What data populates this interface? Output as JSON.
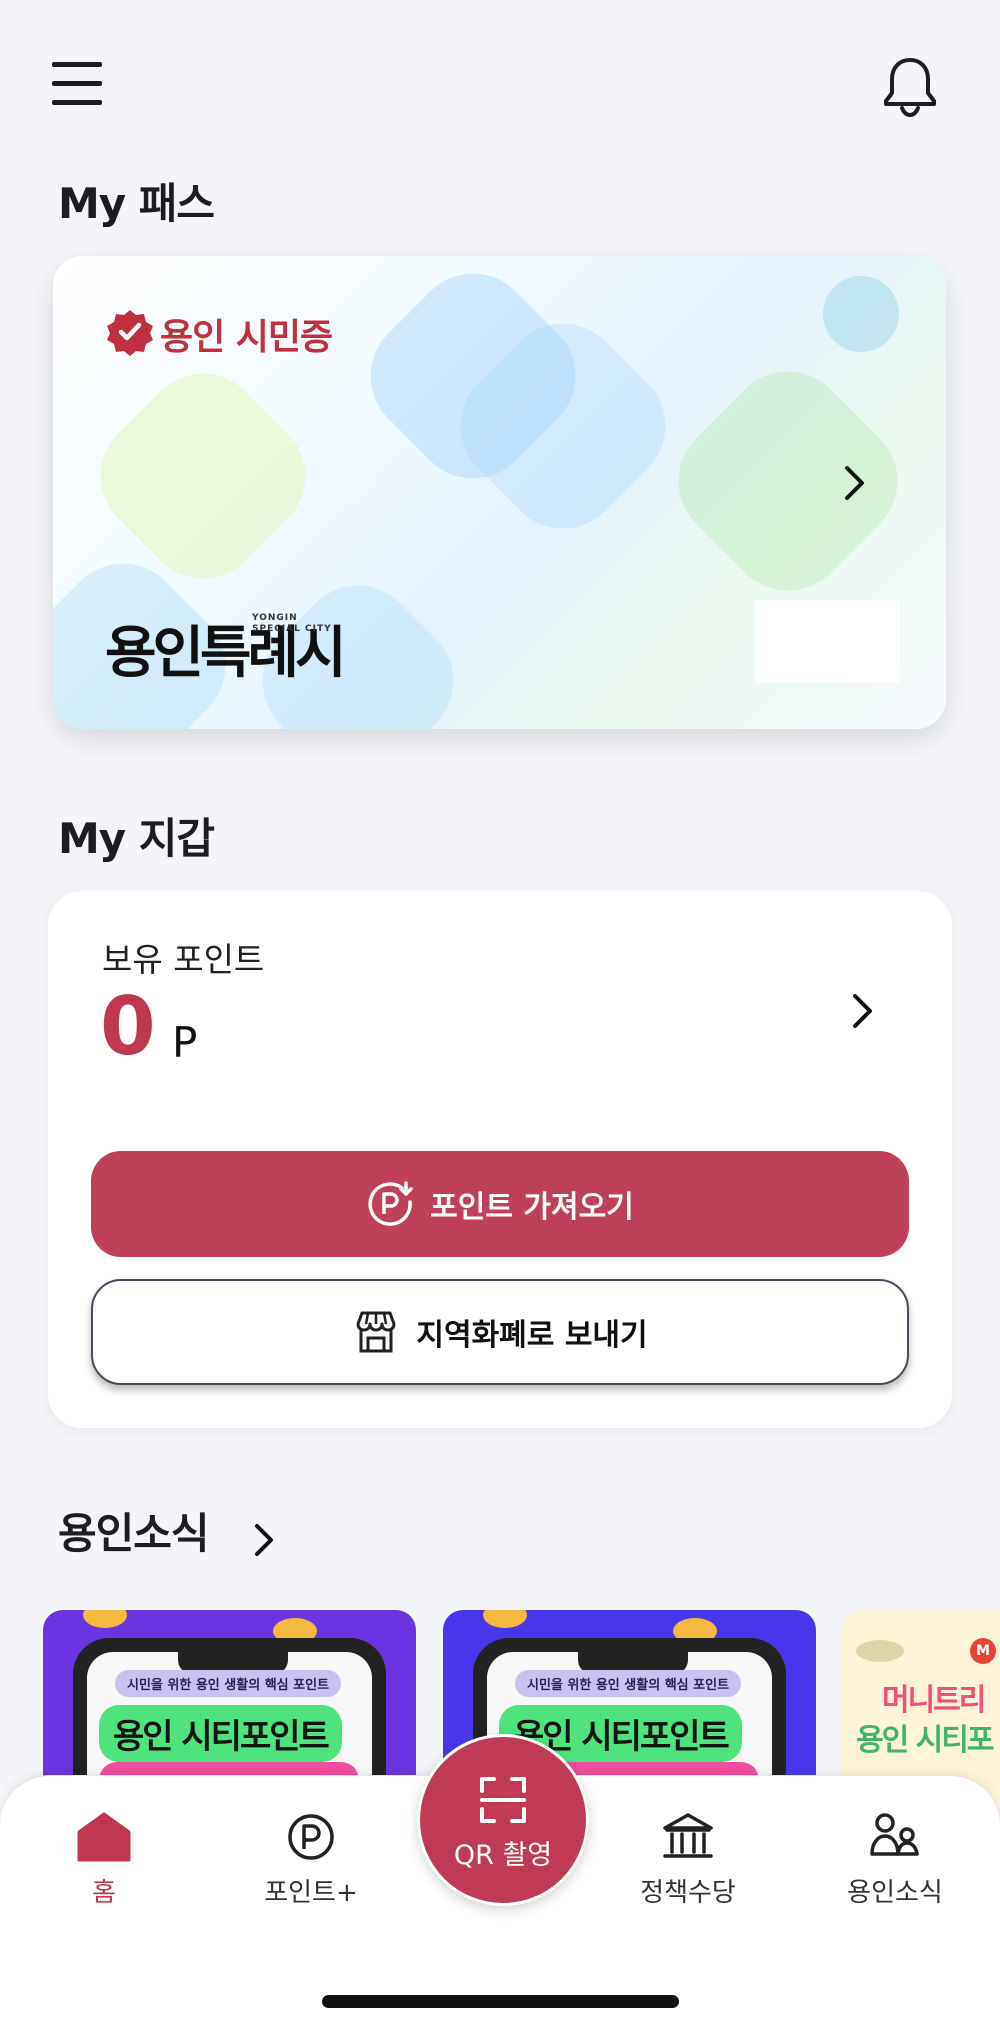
{
  "header": {
    "menu_icon": "hamburger-menu-icon",
    "notification_icon": "bell-icon"
  },
  "my_pass": {
    "title": "My 패스",
    "card": {
      "badge_text": "용인 시민증",
      "badge_icon": "verified-badge-icon",
      "logo_text": "용인특례시",
      "logo_subtext": "YONGIN\nSPECIAL CITY",
      "arrow_icon": "chevron-right-icon"
    }
  },
  "my_wallet": {
    "title": "My 지갑",
    "points_label": "보유 포인트",
    "points_value": "0",
    "points_unit": "P",
    "import_button": "포인트 가져오기",
    "send_button": "지역화폐로 보내기",
    "accent_color": "#be4159"
  },
  "news": {
    "title": "용인소식",
    "cards": [
      {
        "tagline": "시민을 위한 용인 생활의 핵심 포인트",
        "headline": "용인 시티포인트",
        "background": "#6a35e0"
      },
      {
        "tagline": "시민을 위한 용인 생활의 핵심 포인트",
        "headline": "용인 시티포인트",
        "background": "#4a36ea"
      },
      {
        "line1": "머니트리",
        "line2": "용인 시티포",
        "badge": "M",
        "background": "#fdf3d6"
      }
    ]
  },
  "bottom_nav": {
    "items": [
      {
        "label": "홈",
        "icon": "home-icon",
        "active": true
      },
      {
        "label": "포인트+",
        "icon": "point-icon",
        "active": false
      },
      {
        "label": "정책수당",
        "icon": "bank-icon",
        "active": false
      },
      {
        "label": "용인소식",
        "icon": "people-icon",
        "active": false
      }
    ],
    "qr_label": "QR 촬영",
    "qr_icon": "qr-scan-icon"
  }
}
